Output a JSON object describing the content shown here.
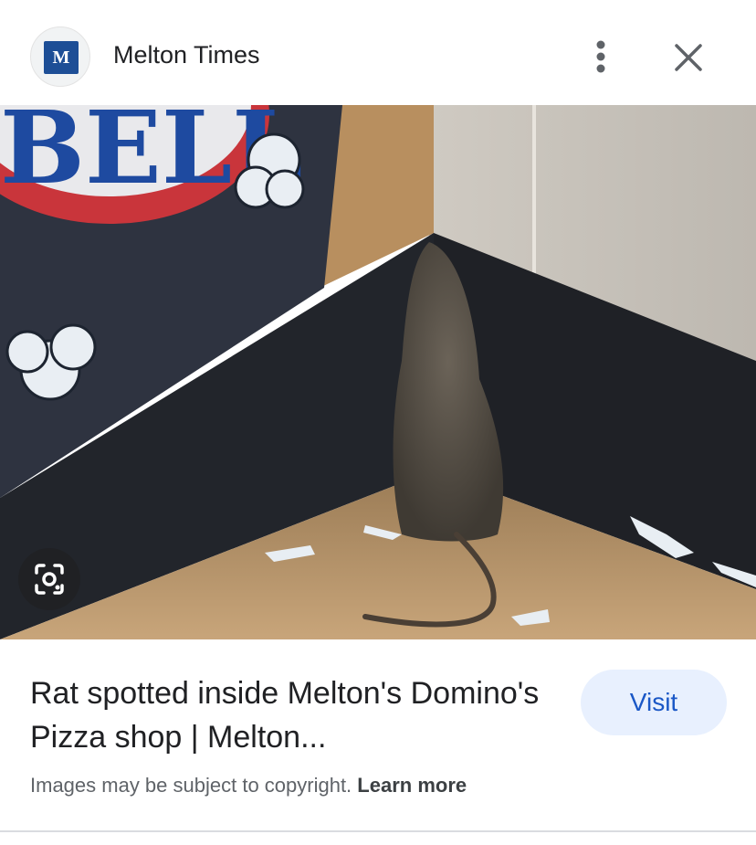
{
  "header": {
    "site_logo_letter": "M",
    "site_name": "Melton Times",
    "more_icon": "more-vert-icon",
    "close_icon": "close-icon"
  },
  "image": {
    "lens_icon": "lens-icon",
    "sign_text": "BELL"
  },
  "result": {
    "title": "Rat spotted inside Melton's Domino's Pizza shop | Melton...",
    "visit_label": "Visit",
    "copyright_text": "Images may be subject to copyright.",
    "learn_more_label": "Learn more"
  },
  "colors": {
    "brand_blue": "#1d4e96",
    "visit_bg": "#e8f0fe",
    "visit_text": "#1a57c6"
  }
}
